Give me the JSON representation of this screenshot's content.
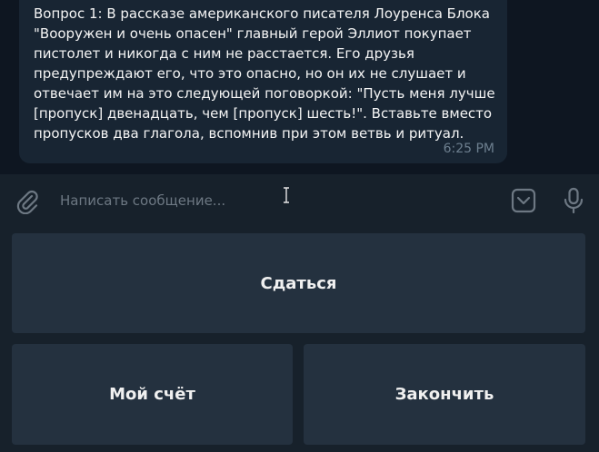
{
  "message": {
    "text": "Вопрос 1: В рассказе американского писателя Лоуренса Блока \"Вооружен и очень опасен\" главный герой Эллиот покупает пистолет и никогда с ним не расстается. Его друзья предупреждают его, что это опасно, но он их не слушает и отвечает им на это следующей поговоркой: \"Пусть меня лучше [пропуск] двенадцать, чем [пропуск] шесть!\". Вставьте вместо пропусков два глагола, вспомнив при этом ветвь и ритуал.",
    "time": "6:25 PM"
  },
  "composer": {
    "placeholder": "Написать сообщение...",
    "icons": [
      "paperclip-icon",
      "sticker-icon",
      "microphone-icon"
    ]
  },
  "keyboard": {
    "surrender_label": "Сдаться",
    "score_label": "Мой счёт",
    "finish_label": "Закончить"
  },
  "colors": {
    "background": "#0e1621",
    "bubble": "#182533",
    "panel": "#17212b",
    "button": "#24313f",
    "time_text": "#6d7f8f",
    "icon": "#6d7883"
  }
}
